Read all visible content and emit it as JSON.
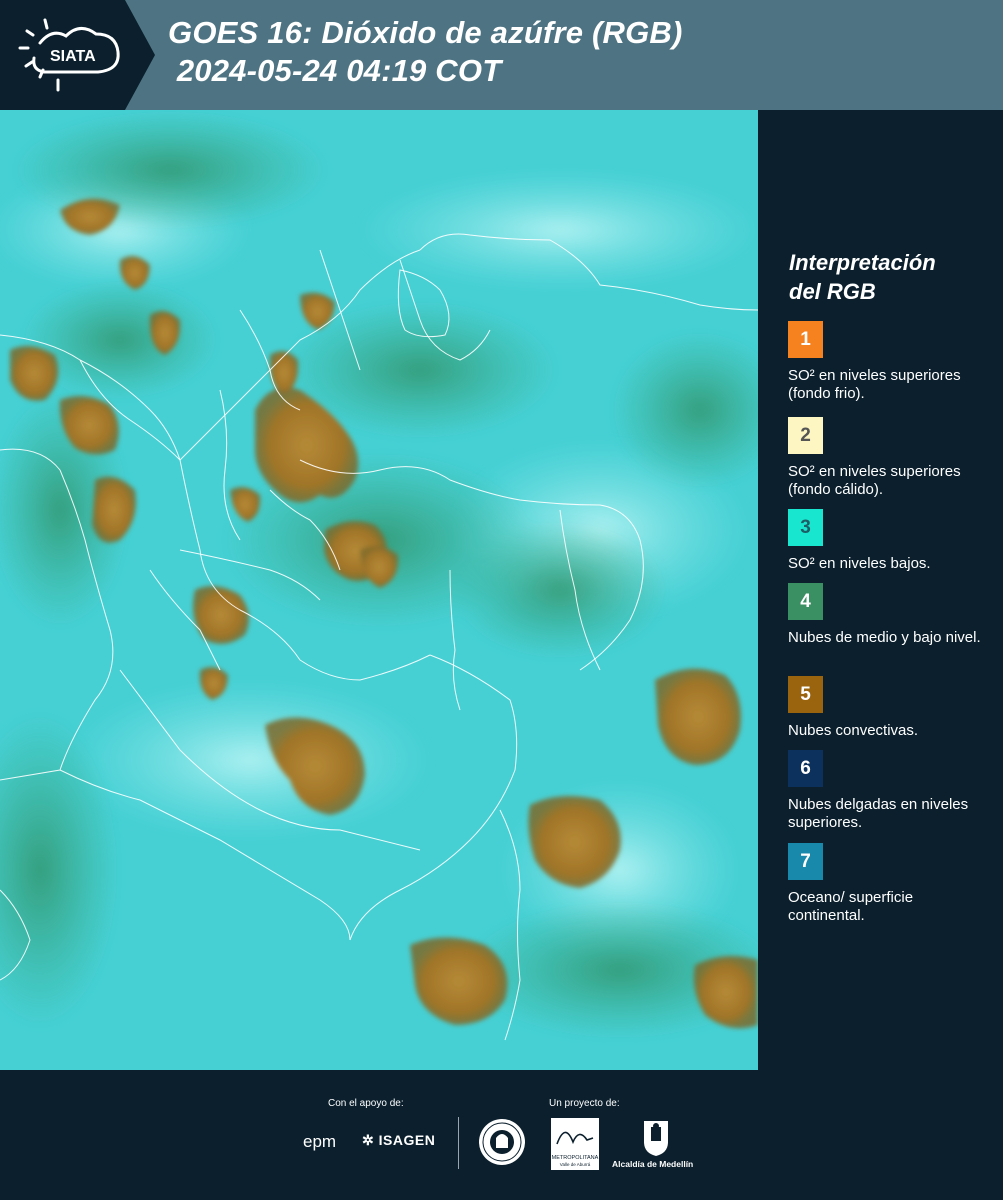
{
  "header": {
    "logo_text": "SIATA",
    "title_line1": "GOES 16: Dióxido de azúfre (RGB)",
    "title_line2": " 2024-05-24 04:19 COT"
  },
  "legend": {
    "title_line1": "Interpretación",
    "title_line2": "del RGB",
    "items": [
      {
        "number": "1",
        "color": "#f5821f",
        "text_color": "#ffffff",
        "description": "SO² en niveles superiores (fondo frio)."
      },
      {
        "number": "2",
        "color": "#fdf6c3",
        "text_color": "#555555",
        "description": "SO² en niveles superiores (fondo cálido)."
      },
      {
        "number": "3",
        "color": "#19e6cf",
        "text_color": "#1d5e66",
        "description": "SO² en niveles bajos."
      },
      {
        "number": "4",
        "color": "#3a8f63",
        "text_color": "#ffffff",
        "description": "Nubes de medio y bajo nivel."
      },
      {
        "number": "5",
        "color": "#9a640f",
        "text_color": "#ffffff",
        "description": "Nubes convectivas."
      },
      {
        "number": "6",
        "color": "#0b315c",
        "text_color": "#ffffff",
        "description": "Nubes delgadas en niveles superiores."
      },
      {
        "number": "7",
        "color": "#1889ab",
        "text_color": "#ffffff",
        "description": "Oceano/ superficie continental."
      }
    ]
  },
  "footer": {
    "support_label": "Con el apoyo de:",
    "project_label": "Un proyecto de:",
    "epm": "epm",
    "isagen": "ISAGEN",
    "area_metropolitana": "METROPOLITANA",
    "area_sub": "Valle de Aburrá",
    "alcaldia": "Alcaldía de Medellín"
  },
  "colors": {
    "header_bg": "#4e7483",
    "panel_bg": "#0b1f2d",
    "map_cyan": "#46d0d4",
    "cloud_brown": "#a57a2a",
    "cloud_green": "#3a9c6c"
  }
}
